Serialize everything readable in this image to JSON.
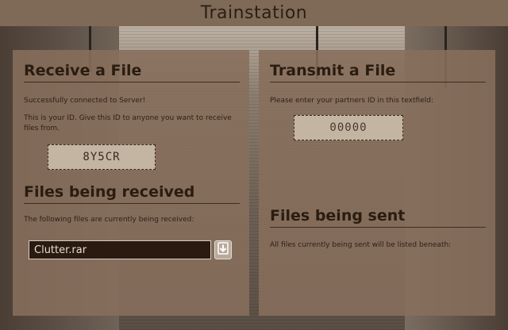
{
  "window": {
    "title": "Trainstation"
  },
  "receive": {
    "heading": "Receive a File",
    "status": "Successfully connected to Server!",
    "id_hint": "This is your ID. Give this ID to anyone you want to receive files from.",
    "my_id": "8Y5CR"
  },
  "receiving": {
    "heading": "Files being received",
    "hint": "The following files are currently being received:",
    "files": [
      {
        "name": "Clutter.rar",
        "action_icon": "download-icon"
      }
    ]
  },
  "transmit": {
    "heading": "Transmit a File",
    "hint": "Please enter your partners ID in this textfield:",
    "partner_id_value": "00000"
  },
  "sending": {
    "heading": "Files being sent",
    "hint": "All files currently being sent will be listed beneath:"
  },
  "colors": {
    "panel": "#876e5c",
    "titlebar": "#7f6a58",
    "text": "#2b1c10",
    "file_row": "#2a1a10"
  }
}
